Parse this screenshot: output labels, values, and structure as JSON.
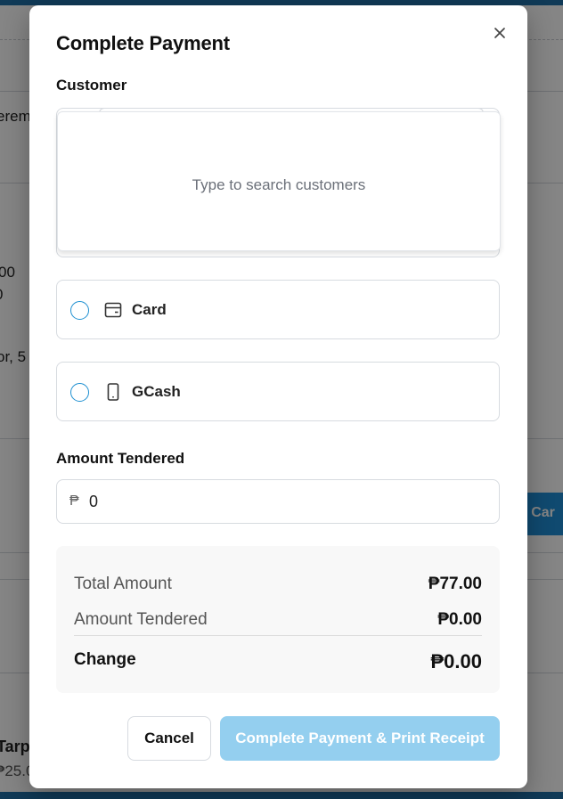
{
  "background": {
    "fragments": [
      "eremi",
      "00",
      "0",
      "or, 5",
      "o Car",
      "Tarp",
      "₱25.0"
    ]
  },
  "modal": {
    "title": "Complete Payment",
    "customer": {
      "label": "Customer",
      "dropdown_empty_text": "Type to search customers"
    },
    "payment_methods": [
      {
        "label": "Card",
        "icon": "card-icon",
        "selected": false
      },
      {
        "label": "GCash",
        "icon": "mobile-phone-icon",
        "selected": false
      }
    ],
    "amount_tendered": {
      "label": "Amount Tendered",
      "currency_prefix": "₱",
      "value": "0"
    },
    "summary": {
      "total_amount_label": "Total Amount",
      "total_amount_value": "₱77.00",
      "amount_tendered_label": "Amount Tendered",
      "amount_tendered_value": "₱0.00",
      "change_label": "Change",
      "change_value": "₱0.00"
    },
    "buttons": {
      "cancel": "Cancel",
      "complete": "Complete Payment & Print Receipt"
    }
  },
  "colors": {
    "accent": "#1d8fd1",
    "primary_disabled": "#94cfef",
    "overlay": "rgba(0,0,0,0.48)"
  }
}
